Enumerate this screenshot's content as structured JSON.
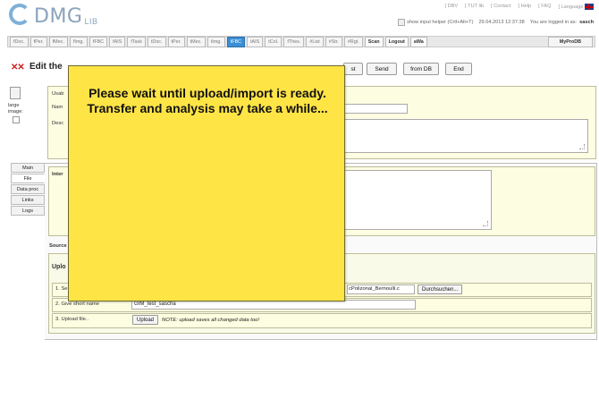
{
  "logo": {
    "text": "DMG",
    "sub": "LIB"
  },
  "topnav": [
    "[ DBV",
    "[ TUT lib",
    "[ Contact",
    "[ Help",
    "[ FAQ",
    "[ Language"
  ],
  "header": {
    "helper_label": "show input helper (Crtl+Alt+T)",
    "datetime": "29.04.2013 12:37:38",
    "logged_in_label": "You are logged in as:",
    "user": "sasch"
  },
  "tabs": [
    {
      "label": "fDoc.",
      "kind": "tab"
    },
    {
      "label": "fPer.",
      "kind": "tab"
    },
    {
      "label": "fMec.",
      "kind": "tab"
    },
    {
      "label": "fImg.",
      "kind": "tab"
    },
    {
      "label": "fFBC",
      "kind": "tab"
    },
    {
      "label": "fAIS",
      "kind": "tab"
    },
    {
      "label": "fTask",
      "kind": "tab"
    },
    {
      "label": "tDoc.",
      "kind": "tab"
    },
    {
      "label": "tPer.",
      "kind": "tab"
    },
    {
      "label": "tMec.",
      "kind": "tab"
    },
    {
      "label": "tImg.",
      "kind": "tab"
    },
    {
      "label": "tFBC",
      "kind": "active"
    },
    {
      "label": "tAIS",
      "kind": "tab"
    },
    {
      "label": "tCol.",
      "kind": "tab"
    },
    {
      "label": "fThes.",
      "kind": "tab"
    },
    {
      "label": "#List",
      "kind": "tab"
    },
    {
      "label": "#Str.",
      "kind": "tab"
    },
    {
      "label": "#Rgt.",
      "kind": "tab"
    },
    {
      "label": "Scan",
      "kind": "btn"
    },
    {
      "label": "Logout",
      "kind": "btn"
    },
    {
      "label": "aWa",
      "kind": "btn"
    }
  ],
  "myprodb": "MyProDB",
  "title": {
    "marks": "✕✕",
    "text": "Edit the"
  },
  "actions": {
    "list": "st",
    "send": "Send",
    "fromdb": "from DB",
    "end": "End"
  },
  "image": {
    "label_line1": "large",
    "label_line2": "image:"
  },
  "form": {
    "usab": "Usab",
    "name": "Nam",
    "desc": "Desc"
  },
  "nav": [
    "Main",
    "File",
    "Data proc",
    "Links",
    "Logs"
  ],
  "file": {
    "inter": "Inter",
    "source": "Source",
    "upload_head": "Uplo",
    "step1_label": "1. Se",
    "step1_value": "cPolizonal_Bernoulli.c",
    "browse": "Durchsuchen...",
    "step2_label": "2. Give short name",
    "step2_value": "GIM_test_sascha",
    "step3_label": "3. Upload file..",
    "upload_btn": "Upload",
    "note": "NOTE: upload saves all changed data too!"
  },
  "overlay": {
    "message": "Please wait until upload/import is ready. Transfer and analysis may take a while..."
  }
}
